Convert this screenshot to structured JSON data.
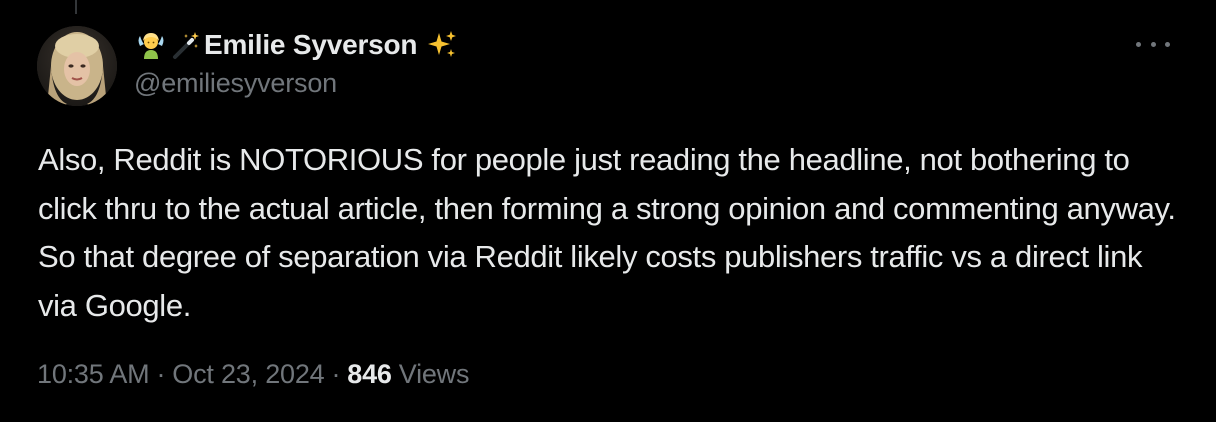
{
  "tweet": {
    "author": {
      "name_emoji_prefix": [
        "person-emoji",
        "magic-wand-emoji"
      ],
      "display_name": "Emilie Syverson",
      "name_emoji_suffix": "sparkles-emoji",
      "handle": "@emiliesyverson"
    },
    "text": "Also, Reddit is NOTORIOUS for people just reading the headline, not bothering to click thru to the actual article, then forming a strong opinion and commenting anyway. So that degree of separation via Reddit likely costs publishers traffic vs a direct link via Google.",
    "time": "10:35 AM",
    "separator": "·",
    "date": "Oct 23, 2024",
    "views_count": "846",
    "views_label": "Views"
  },
  "icons": {
    "more": "more-horizontal-icon"
  },
  "colors": {
    "background": "#000000",
    "text_primary": "#e7e9ea",
    "text_secondary": "#71767b",
    "sparkle": "#f6c130"
  }
}
